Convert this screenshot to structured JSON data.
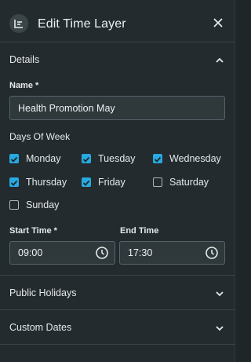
{
  "header": {
    "title": "Edit Time Layer",
    "icon": "layers-icon"
  },
  "details": {
    "title": "Details",
    "name_label": "Name *",
    "name_value": "Health Promotion May",
    "days_label": "Days Of Week",
    "days": [
      {
        "label": "Monday",
        "checked": true
      },
      {
        "label": "Tuesday",
        "checked": true
      },
      {
        "label": "Wednesday",
        "checked": true
      },
      {
        "label": "Thursday",
        "checked": true
      },
      {
        "label": "Friday",
        "checked": true
      },
      {
        "label": "Saturday",
        "checked": false
      },
      {
        "label": "Sunday",
        "checked": false
      }
    ],
    "start_label": "Start Time *",
    "start_value": "09:00",
    "end_label": "End Time",
    "end_value": "17:30"
  },
  "sections": {
    "public_holidays": "Public Holidays",
    "custom_dates": "Custom Dates"
  },
  "colors": {
    "accent": "#27a9e1",
    "panel": "#232b2e",
    "input": "#2f393c"
  }
}
